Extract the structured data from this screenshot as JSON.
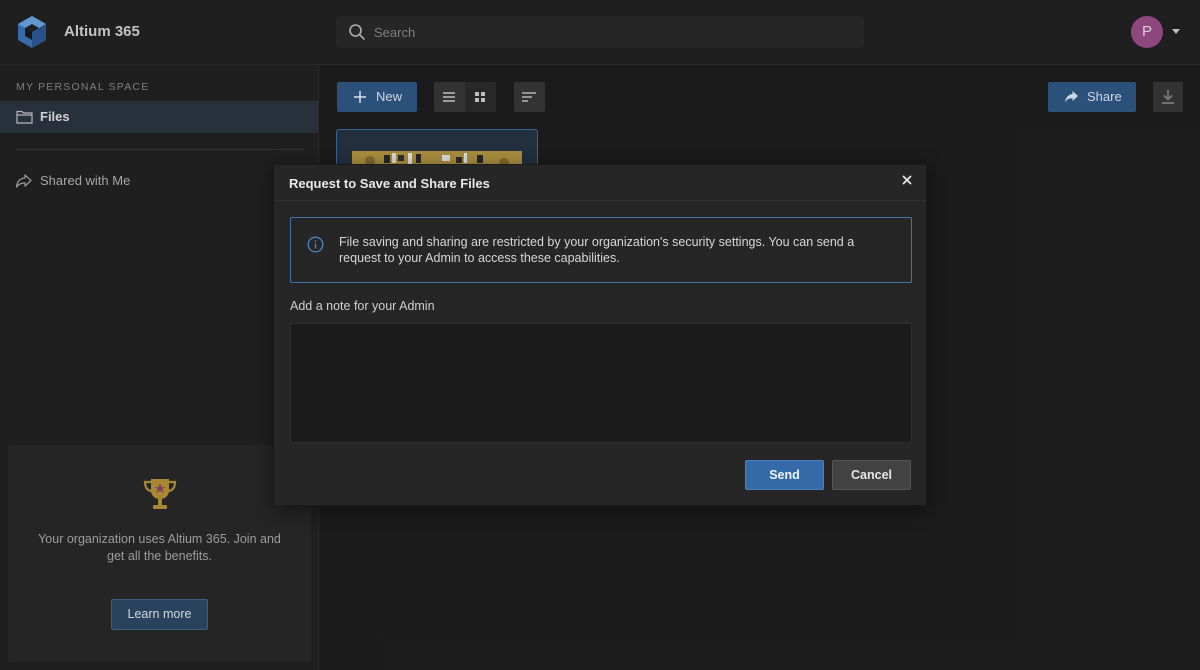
{
  "app": {
    "title": "Altium 365",
    "logo_icon": "altium-cube-logo"
  },
  "search": {
    "placeholder": "Search",
    "value": ""
  },
  "user": {
    "avatar_initial": "P",
    "avatar_color": "#9c4e8b"
  },
  "sidebar": {
    "section_label": "MY PERSONAL SPACE",
    "items": [
      {
        "label": "Files",
        "icon": "folder-icon",
        "active": true
      },
      {
        "label": "Shared with Me",
        "icon": "share-arrow-icon",
        "active": false
      }
    ],
    "promo": {
      "icon": "trophy-icon",
      "text": "Your organization uses Altium 365. Join and get all the benefits.",
      "button_label": "Learn more"
    }
  },
  "toolbar": {
    "new_label": "New",
    "share_label": "Share",
    "view_modes": [
      "list",
      "grid"
    ],
    "active_view": "list"
  },
  "modal": {
    "title": "Request to Save and Share Files",
    "info_text": "File saving and sharing are restricted by your organization's security settings. You can send a request to your Admin to access these capabilities.",
    "note_label": "Add a note for your Admin",
    "note_value": "",
    "send_label": "Send",
    "cancel_label": "Cancel"
  },
  "colors": {
    "accent": "#2f5785",
    "primary_button": "#346aa8",
    "info_border": "#3f74ad",
    "background": "#1e1e1e"
  }
}
